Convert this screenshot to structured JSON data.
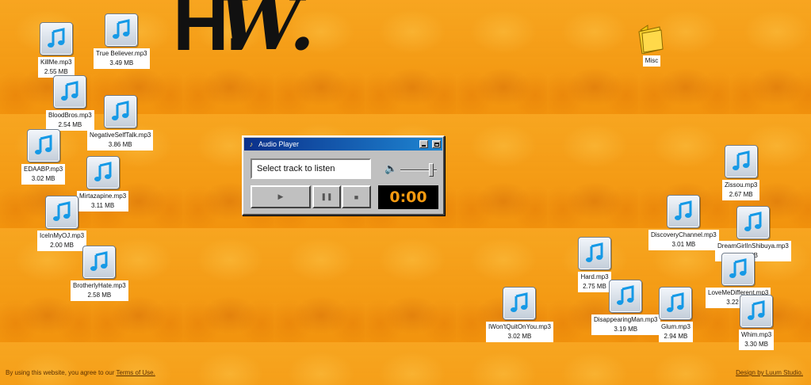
{
  "logo": {
    "letter_h": "H.",
    "letter_w": "W."
  },
  "files": [
    {
      "name": "KillMe.mp3",
      "size": "2.55 MB"
    },
    {
      "name": "True Believer.mp3",
      "size": "3.49 MB"
    },
    {
      "name": "BloodBros.mp3",
      "size": "2.54 MB"
    },
    {
      "name": "NegativeSelfTalk.mp3",
      "size": "3.86 MB"
    },
    {
      "name": "EDAABP.mp3",
      "size": "3.02 MB"
    },
    {
      "name": "Mirtazapine.mp3",
      "size": "3.11 MB"
    },
    {
      "name": "IceInMyOJ.mp3",
      "size": "2.00 MB"
    },
    {
      "name": "BrotherlyHate.mp3",
      "size": "2.58 MB"
    },
    {
      "name": "IWon'tQuitOnYou.mp3",
      "size": "3.02 MB"
    },
    {
      "name": "Hard.mp3",
      "size": "2.75 MB"
    },
    {
      "name": "DisappearingMan.mp3",
      "size": "3.19 MB"
    },
    {
      "name": "Glum.mp3",
      "size": "2.94 MB"
    },
    {
      "name": "DiscoveryChannel.mp3",
      "size": "3.01 MB"
    },
    {
      "name": "Zissou.mp3",
      "size": "2.67 MB"
    },
    {
      "name": "DreamGirlInShibuya.mp3",
      "size": "MB"
    },
    {
      "name": "LoveMeDifferent.mp3",
      "size": "3.22 MB"
    },
    {
      "name": "Whim.mp3",
      "size": "3.30 MB"
    }
  ],
  "folder": {
    "name": "Misc",
    "icon": "folder-icon"
  },
  "player": {
    "title": "Audio Player",
    "display_text": "Select track to listen",
    "time": "0:00",
    "volume_level": 0.85,
    "play_symbol": "▶",
    "pause_symbol": "❚❚",
    "stop_symbol": "■",
    "title_icon": "♪",
    "speaker_symbol": "🔈"
  },
  "footer": {
    "left_text": "By using this website, you agree to our ",
    "terms_link": "Terms of Use.",
    "right_link": "Design by Luum Studio."
  },
  "colors": {
    "background": "#f59a10",
    "titlebar_start": "#0b2f8a",
    "titlebar_end": "#1e86d2",
    "timer_text": "#f59a10"
  }
}
